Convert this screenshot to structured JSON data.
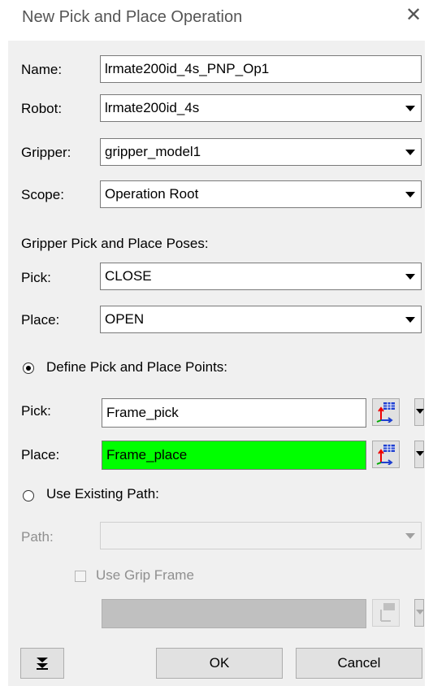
{
  "window": {
    "title": "New Pick and Place Operation",
    "close_glyph": "✕"
  },
  "fields": {
    "name_label": "Name:",
    "name_value": "lrmate200id_4s_PNP_Op1",
    "robot_label": "Robot:",
    "robot_value": "lrmate200id_4s",
    "gripper_label": "Gripper:",
    "gripper_value": "gripper_model1",
    "scope_label": "Scope:",
    "scope_value": "Operation Root"
  },
  "poses": {
    "section_label": "Gripper Pick and Place Poses:",
    "pick_label": "Pick:",
    "pick_value": "CLOSE",
    "place_label": "Place:",
    "place_value": "OPEN"
  },
  "points": {
    "radio_label": "Define Pick and Place Points:",
    "selected": true,
    "pick_label": "Pick:",
    "pick_value": "Frame_pick",
    "place_label": "Place:",
    "place_value": "Frame_place",
    "place_highlight_color": "#00ff00"
  },
  "path": {
    "radio_label": "Use Existing Path:",
    "selected": false,
    "path_label": "Path:",
    "path_value": "",
    "grip_frame_label": "Use Grip Frame",
    "grip_frame_checked": false,
    "grip_frame_value": ""
  },
  "buttons": {
    "expand_icon": "double-chevron-down-icon",
    "ok_label": "OK",
    "cancel_label": "Cancel"
  }
}
